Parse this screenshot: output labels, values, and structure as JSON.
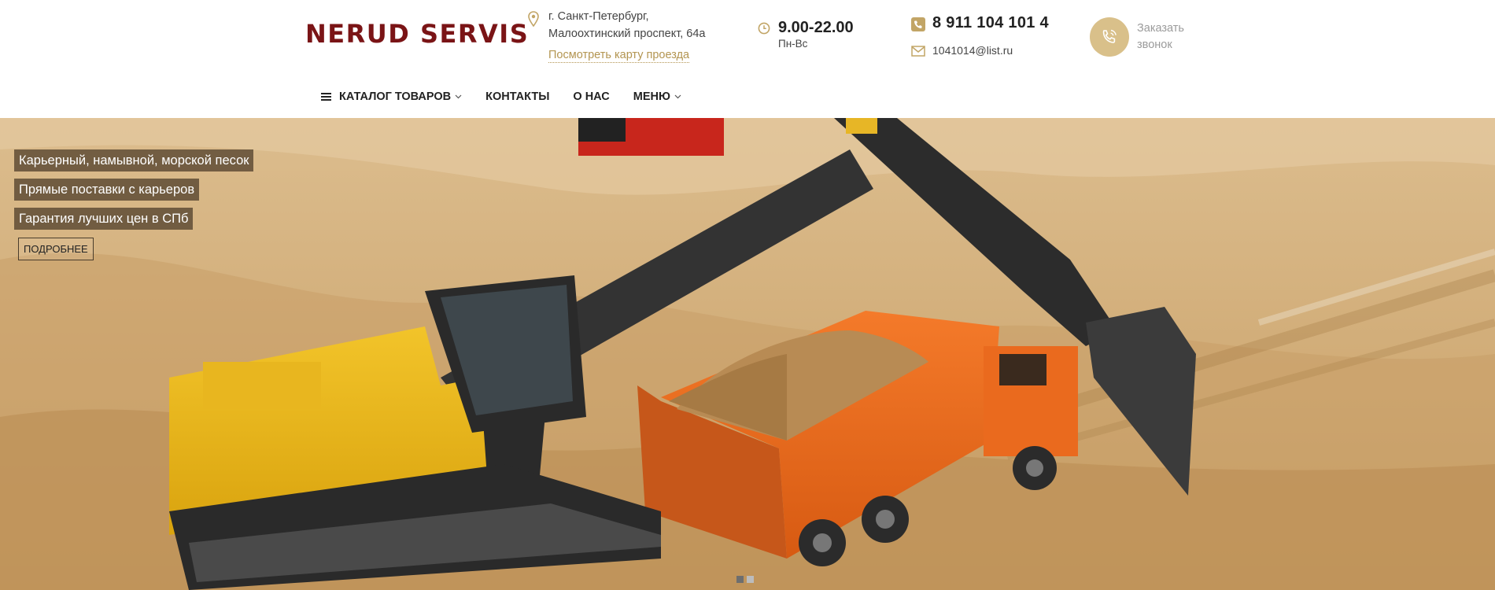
{
  "brand": {
    "logo_text": "NERUD SERVIS",
    "accent_color": "#7a1416",
    "gold_color": "#b39551"
  },
  "address": {
    "line1": "г. Санкт-Петербург,",
    "line2": "Малоохтинский проспект, 64а",
    "map_link": "Посмотреть карту проезда",
    "icon": "map-pin-icon"
  },
  "hours": {
    "time": "9.00-22.00",
    "days": "Пн-Вс",
    "icon": "clock-icon"
  },
  "contacts": {
    "phone": "8 911 104 101 4",
    "email": "1041014@list.ru",
    "phone_icon": "phone-icon",
    "email_icon": "envelope-icon"
  },
  "callback": {
    "line1": "Заказать",
    "line2": "звонок",
    "icon": "phone-ring-icon"
  },
  "nav": {
    "catalog": "КАТАЛОГ ТОВАРОВ",
    "contacts": "КОНТАКТЫ",
    "about": "О НАС",
    "menu": "МЕНЮ"
  },
  "hero": {
    "tags": [
      "Карьерный, намывной, морской песок",
      "Прямые поставки с карьеров",
      "Гарантия лучших цен в СПб"
    ],
    "button": "ПОДРОБНЕЕ",
    "slides_total": 2,
    "active_slide": 1
  }
}
